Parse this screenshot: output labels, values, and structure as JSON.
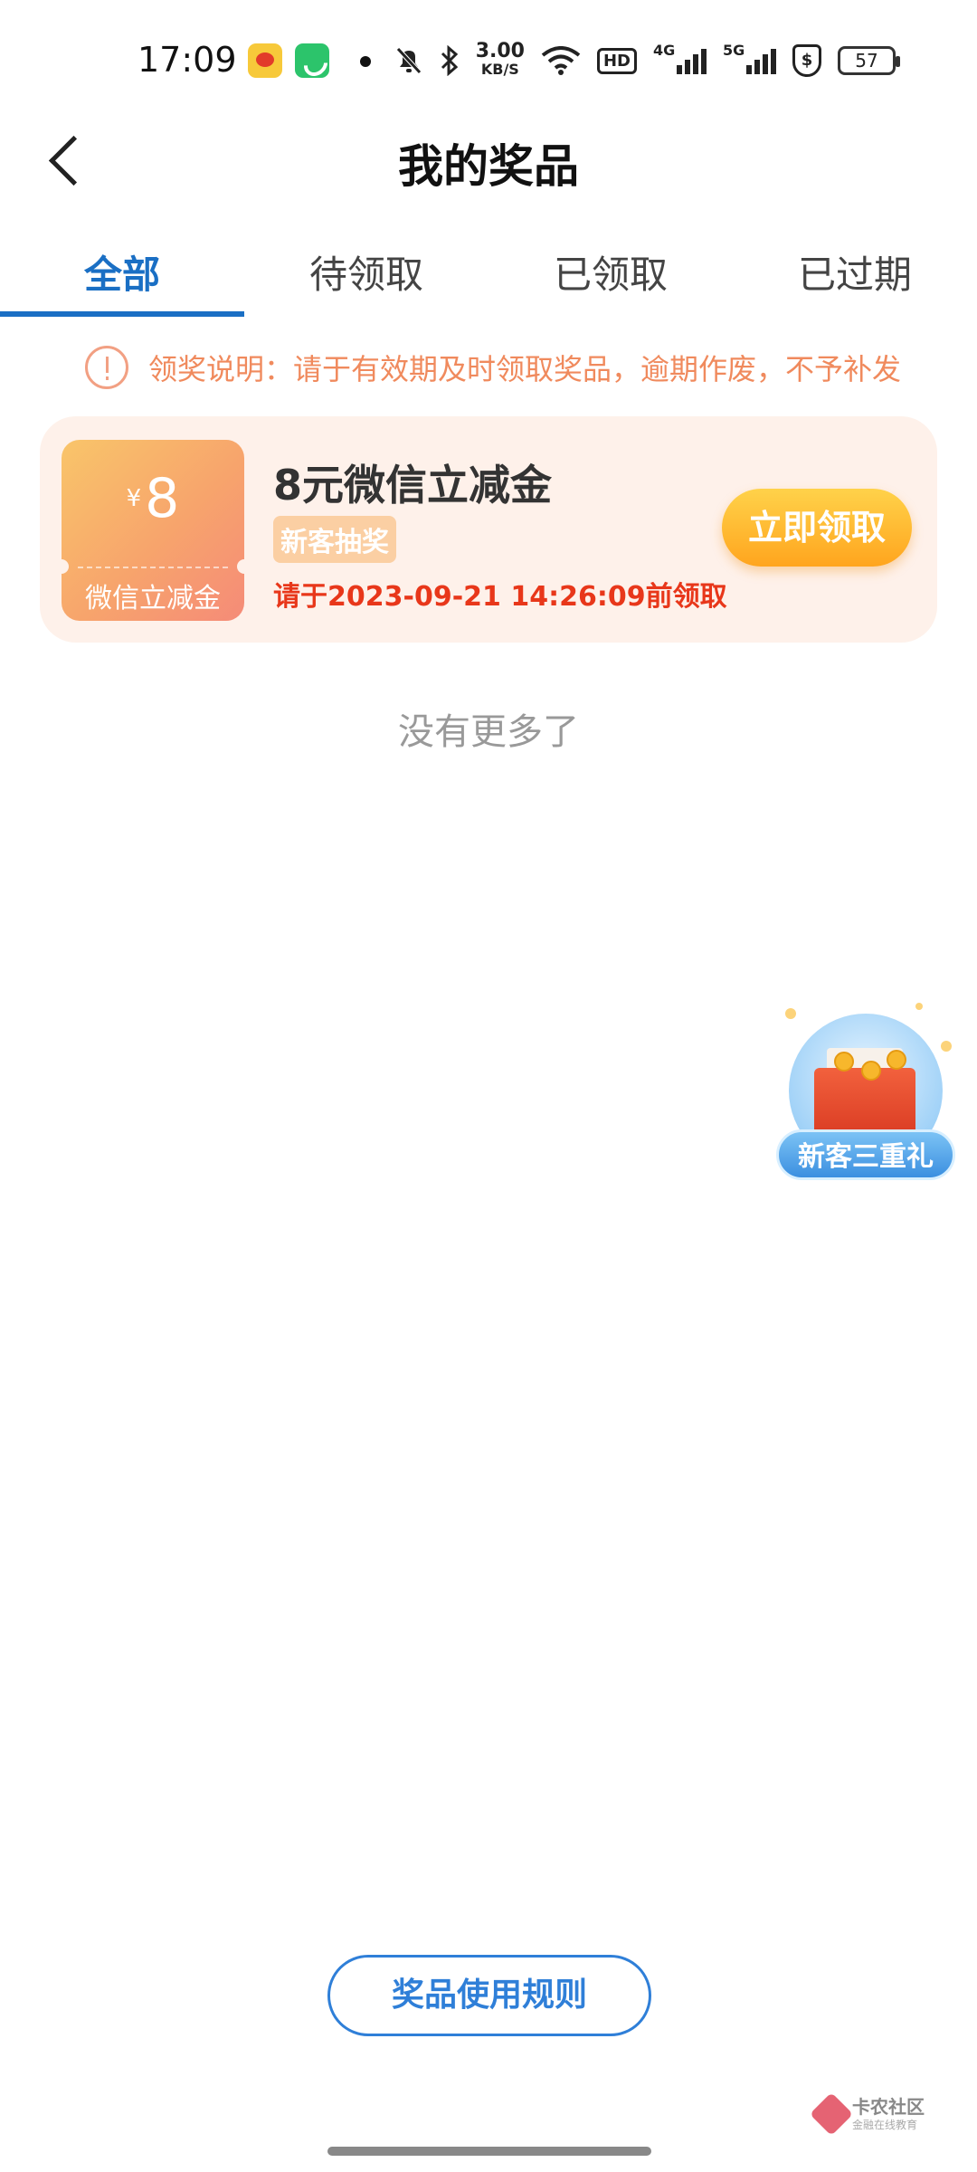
{
  "status_bar": {
    "time": "17:09",
    "net_speed_value": "3.00",
    "net_speed_unit": "KB/S",
    "hd_badge": "HD",
    "signal_1_tag": "4G",
    "signal_2_tag": "5G",
    "shield_symbol": "$",
    "battery": "57",
    "icons": [
      "weibo-icon",
      "phone-call-icon",
      "notification-dot",
      "mute-bell-icon",
      "bluetooth-icon",
      "wifi-icon",
      "signal-icon",
      "secure-payment-icon",
      "battery-icon"
    ]
  },
  "header": {
    "title": "我的奖品",
    "back_icon": "chevron-left-icon"
  },
  "tabs": [
    {
      "label": "全部",
      "active": true
    },
    {
      "label": "待领取",
      "active": false
    },
    {
      "label": "已领取",
      "active": false
    },
    {
      "label": "已过期",
      "active": false
    }
  ],
  "notice": {
    "text": "领奖说明：请于有效期及时领取奖品，逾期作废，不予补发",
    "color": "#f08a5d"
  },
  "prizes": [
    {
      "currency": "¥",
      "amount": "8",
      "coupon_label": "微信立减金",
      "title": "8元微信立减金",
      "tag": "新客抽奖",
      "deadline": "请于2023-09-21 14:26:09前领取",
      "claim_label": "立即领取"
    }
  ],
  "list_end_text": "没有更多了",
  "floating_gift": {
    "label": "新客三重礼"
  },
  "rules_button": "奖品使用规则",
  "watermark": {
    "title": "卡农社区",
    "subtitle": "金融在线教育"
  },
  "colors": {
    "accent": "#1a6fc4",
    "deadline": "#e8371a",
    "claim_button": "#ffa51e",
    "card_bg": "#fef1ea"
  }
}
